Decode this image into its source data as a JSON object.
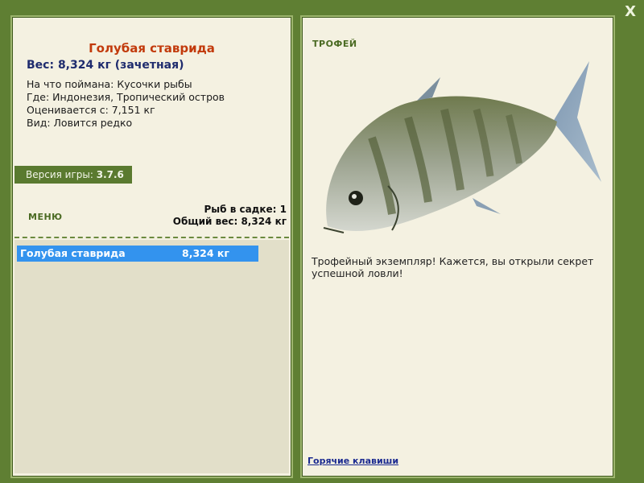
{
  "window": {
    "close_label": "X"
  },
  "fish": {
    "title": "Голубая ставрида",
    "weight_line": "Вес: 8,324 кг (зачетная)",
    "caught_with": "На что поймана: Кусочки рыбы",
    "where": "Где: Индонезия, Тропический остров",
    "valued_from": "Оценивается с: 7,151 кг",
    "kind": "Вид: Ловится редко"
  },
  "version": {
    "label": "Версия игры:",
    "value": "3.7.6"
  },
  "menu": {
    "label": "МЕНЮ"
  },
  "stats": {
    "fish_count": "Рыб в садке: 1",
    "total_weight": "Общий вес: 8,324 кг"
  },
  "catch_list": [
    {
      "name": "Голубая ставрида",
      "weight": "8,324 кг"
    }
  ],
  "right": {
    "trophy_label": "ТРОФЕЙ",
    "trophy_text": "Трофейный экземпляр! Кажется, вы открыли секрет успешной ловли!",
    "hotkeys_link": "Горячие клавиши"
  },
  "colors": {
    "background": "#5f7f33",
    "panel": "#f4f1e1",
    "selected_row": "#3393ee",
    "title": "#c23a0c",
    "weight": "#1f2c6e"
  }
}
